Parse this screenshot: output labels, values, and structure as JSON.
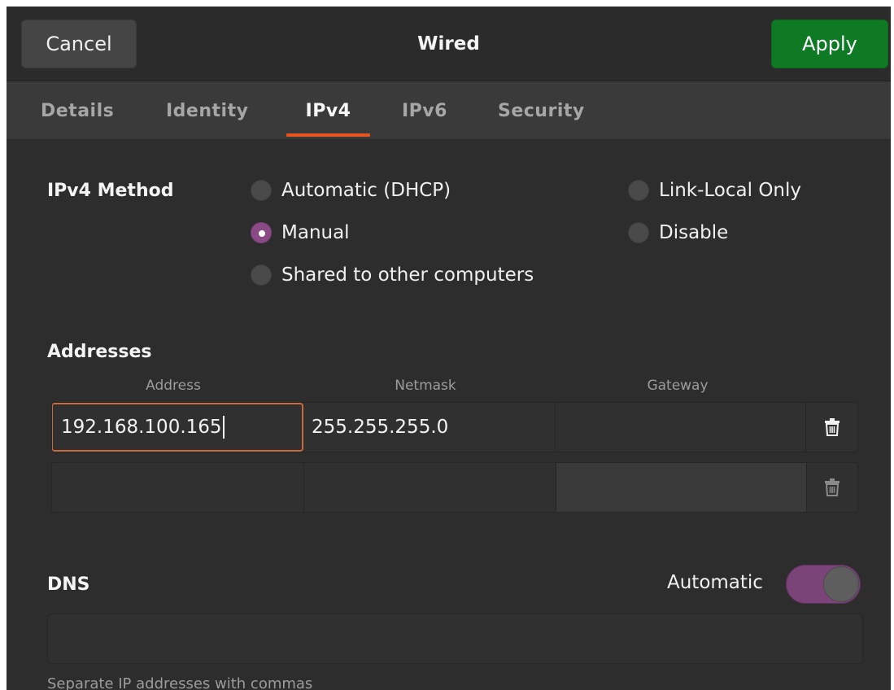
{
  "window": {
    "title": "Wired"
  },
  "header": {
    "cancel_label": "Cancel",
    "apply_label": "Apply"
  },
  "tabs": [
    {
      "label": "Details",
      "active": false
    },
    {
      "label": "Identity",
      "active": false
    },
    {
      "label": "IPv4",
      "active": true
    },
    {
      "label": "IPv6",
      "active": false
    },
    {
      "label": "Security",
      "active": false
    }
  ],
  "ipv4_method": {
    "label": "IPv4 Method",
    "options": [
      {
        "label": "Automatic (DHCP)",
        "checked": false
      },
      {
        "label": "Manual",
        "checked": true
      },
      {
        "label": "Shared to other computers",
        "checked": false
      },
      {
        "label": "Link-Local Only",
        "checked": false
      },
      {
        "label": "Disable",
        "checked": false
      }
    ]
  },
  "addresses": {
    "label": "Addresses",
    "columns": [
      "Address",
      "Netmask",
      "Gateway"
    ],
    "rows": [
      {
        "address": "192.168.100.165",
        "netmask": "255.255.255.0",
        "gateway": ""
      },
      {
        "address": "",
        "netmask": "",
        "gateway": ""
      }
    ]
  },
  "dns": {
    "label": "DNS",
    "automatic_label": "Automatic",
    "automatic_on": true,
    "value": "",
    "hint": "Separate IP addresses with commas"
  },
  "colors": {
    "accent_orange": "#e9541f",
    "apply_green": "#0e7a23",
    "radio_checked": "#8a4a86",
    "switch_on": "#7a4479"
  }
}
